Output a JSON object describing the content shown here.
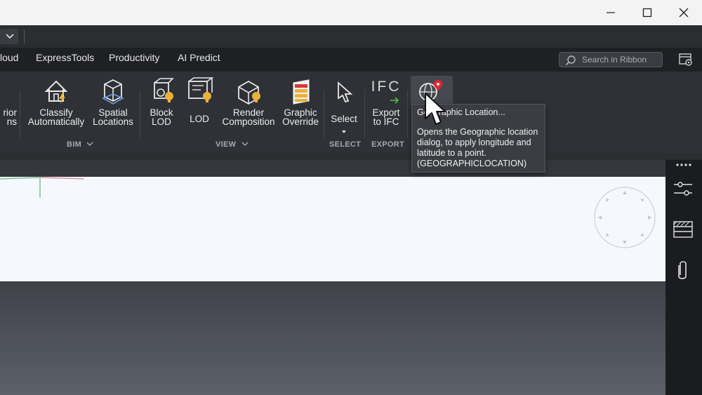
{
  "window": {
    "minimize_label": "Minimize",
    "maximize_label": "Maximize",
    "close_label": "Close"
  },
  "tabs": [
    {
      "label": "loud"
    },
    {
      "label": "ExpressTools"
    },
    {
      "label": "Productivity"
    },
    {
      "label": "AI Predict"
    }
  ],
  "search": {
    "placeholder": "Search in Ribbon"
  },
  "ribbon": {
    "partial_button": {
      "line1": "rior",
      "line2": "ns"
    },
    "bim": {
      "group_label": "BIM",
      "classify": {
        "line1": "Classify",
        "line2": "Automatically"
      },
      "spatial": {
        "line1": "Spatial",
        "line2": "Locations"
      }
    },
    "view": {
      "group_label": "VIEW",
      "block_lod": {
        "line1": "Block",
        "line2": "LOD"
      },
      "lod": {
        "line1": "LOD"
      },
      "render": {
        "line1": "Render",
        "line2": "Composition"
      },
      "graphic": {
        "line1": "Graphic",
        "line2": "Override"
      }
    },
    "select": {
      "group_label": "SELECT",
      "button": {
        "line1": "Select"
      }
    },
    "export": {
      "group_label": "EXPORT",
      "icon_text": "IFC",
      "button": {
        "line1": "Export",
        "line2": "to IFC"
      }
    },
    "geo": {
      "icon": "globe-pin-icon"
    }
  },
  "tooltip": {
    "title": "Geographic Location...",
    "description": "Opens the Geographic location dialog, to apply longitude and latitude to a point. (GEOGRAPHICLOCATION)"
  },
  "colors": {
    "accent_yellow": "#e8b13a",
    "pin_red": "#e0262f",
    "ribbon_bg": "#2f3136"
  }
}
